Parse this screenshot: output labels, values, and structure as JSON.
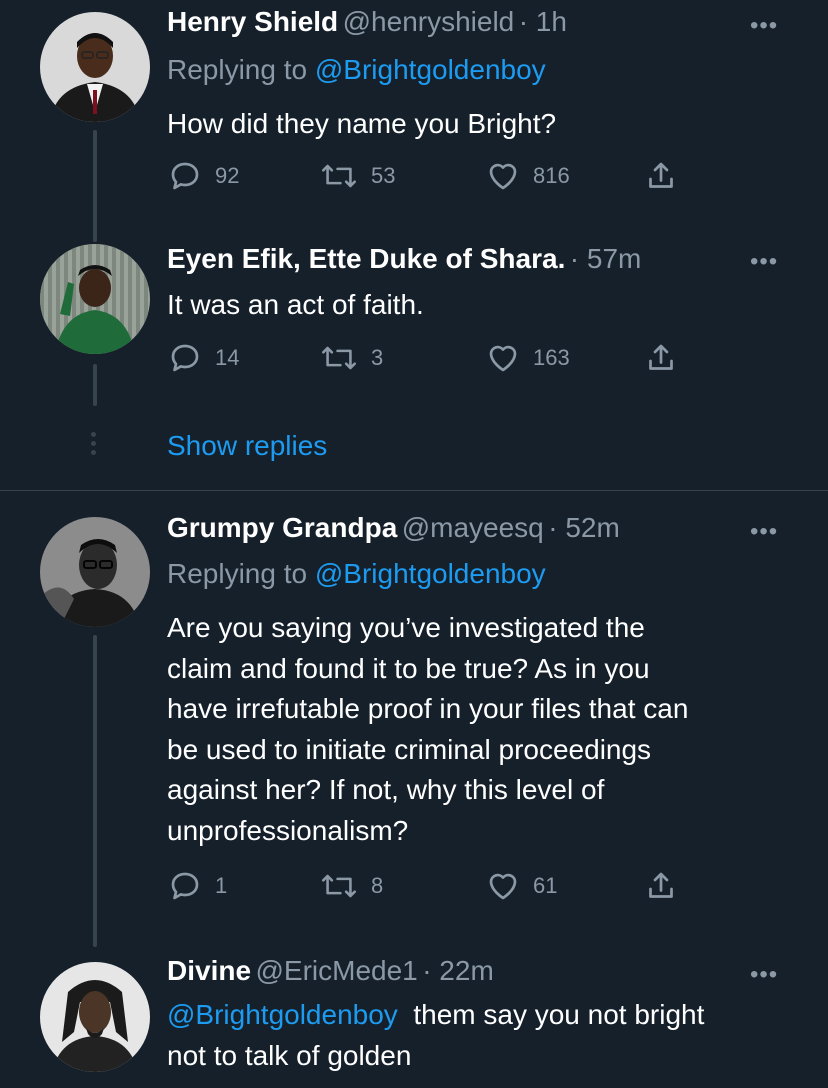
{
  "tweets": [
    {
      "name": "Henry Shield",
      "handle": "@henryshield",
      "time": "· 1h",
      "replying_prefix": "Replying to ",
      "replying_to": "@Brightgoldenboy",
      "text": "How did they name you Bright?",
      "replies": "92",
      "retweets": "53",
      "likes": "816"
    },
    {
      "name": "Eyen Efik, Ette Duke of Shara.",
      "handle": "",
      "time": "· 57m",
      "text": "It was an act of faith.",
      "replies": "14",
      "retweets": "3",
      "likes": "163"
    },
    {
      "name": "Grumpy Grandpa",
      "handle": "@mayeesq",
      "time": "· 52m",
      "replying_prefix": "Replying to ",
      "replying_to": "@Brightgoldenboy",
      "text_lines": [
        "Are you saying you’ve investigated the",
        "claim and found it to be true? As in you",
        "have irrefutable proof in your files that can",
        "be used to initiate criminal proceedings",
        "against her? If not, why this level of",
        "unprofessionalism?"
      ],
      "replies": "1",
      "retweets": "8",
      "likes": "61"
    },
    {
      "name": "Divine",
      "handle": "@EricMede1",
      "time": "· 22m",
      "mention": "@Brightgoldenboy",
      "text_rest": "  them say you not bright",
      "text_line2": "not to talk of golden"
    }
  ],
  "show_replies": "Show replies",
  "more_glyph": "•••",
  "colors": {
    "background": "#15202b",
    "secondary": "#8b98a5",
    "link": "#1d9bf0",
    "divider": "#38444d"
  },
  "icons": [
    "reply-icon",
    "retweet-icon",
    "like-icon",
    "share-icon",
    "more-icon"
  ]
}
